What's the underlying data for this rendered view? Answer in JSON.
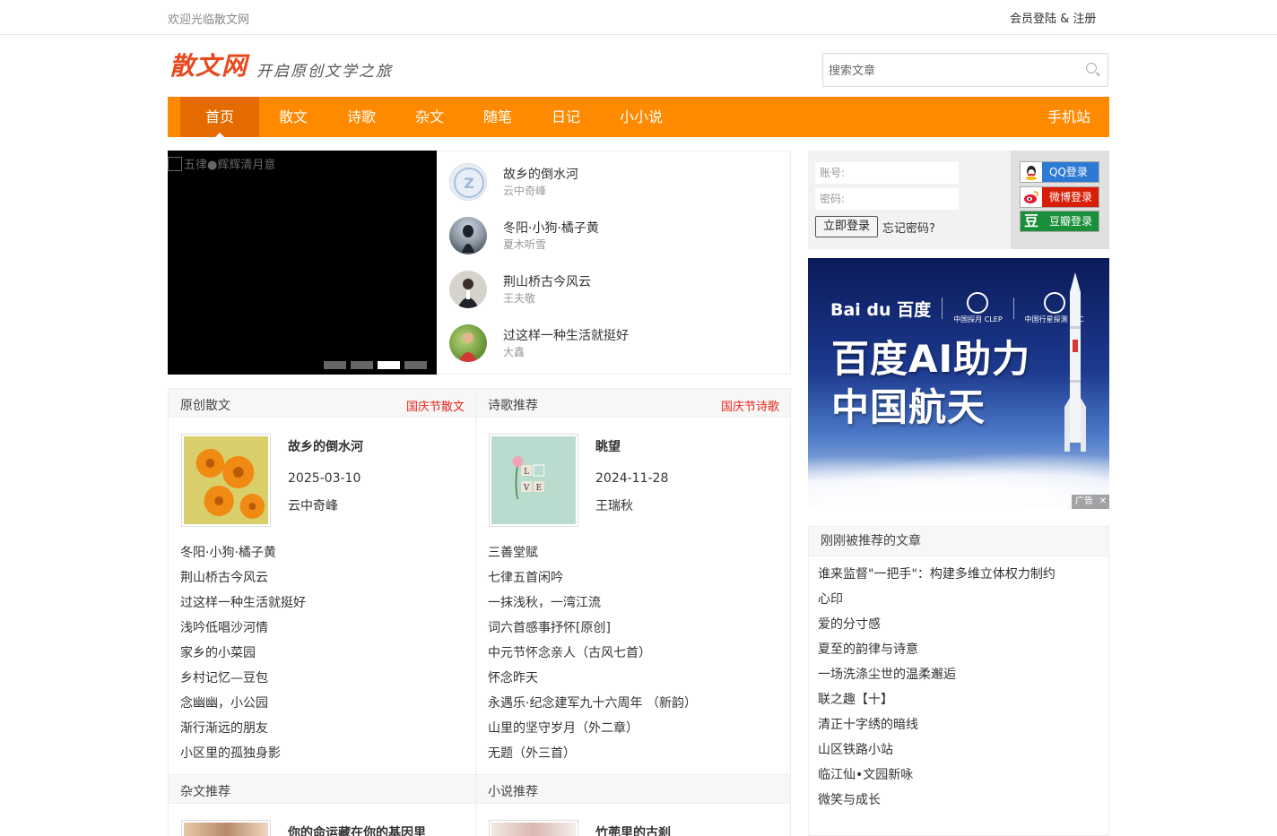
{
  "topbar": {
    "welcome": "欢迎光临散文网",
    "login": "会员登陆 & 注册"
  },
  "header": {
    "logo": "散文网",
    "slogan": "开启原创文学之旅"
  },
  "search": {
    "placeholder": "搜索文章"
  },
  "nav": {
    "items": [
      "首页",
      "散文",
      "诗歌",
      "杂文",
      "随笔",
      "日记",
      "小小说"
    ],
    "mobile": "手机站"
  },
  "slider": {
    "image_alt": "五律●辉辉清月意",
    "slide_count": 4,
    "active_slide": 3
  },
  "featured": [
    {
      "title": "故乡的倒水河",
      "author": "云中奇峰"
    },
    {
      "title": "冬阳·小狗·橘子黄",
      "author": "夏木听雪"
    },
    {
      "title": "荆山桥古今风云",
      "author": "王夫敬"
    },
    {
      "title": "过这样一种生活就挺好",
      "author": "大鑫"
    }
  ],
  "login": {
    "account_placeholder": "账号:",
    "password_placeholder": "密码:",
    "submit": "立即登录",
    "forgot": "忘记密码?",
    "qq": "QQ登录",
    "weibo": "微博登录",
    "douban": "豆瓣登录",
    "douban_logo": "豆"
  },
  "ad": {
    "baidu": "Bai du 百度",
    "org1": "中国探月 CLEP",
    "org2": "中国行星探测 PEC",
    "line1": "百度AI助力",
    "line2": "中国航天",
    "tag": "广告",
    "close": "✕"
  },
  "prose": {
    "title": "原创散文",
    "more": "国庆节散文",
    "post": {
      "title": "故乡的倒水河",
      "date": "2025-03-10",
      "author": "云中奇峰"
    },
    "list": [
      "冬阳·小狗·橘子黄",
      "荆山桥古今风云",
      "过这样一种生活就挺好",
      "浅吟低唱沙河情",
      "家乡的小菜园",
      "乡村记忆—豆包",
      "念幽幽，小公园",
      "渐行渐远的朋友",
      "小区里的孤独身影"
    ]
  },
  "poetry": {
    "title": "诗歌推荐",
    "more": "国庆节诗歌",
    "post": {
      "title": "眺望",
      "date": "2024-11-28",
      "author": "王瑞秋"
    },
    "list": [
      "三善堂赋",
      "七律五首闲吟",
      "一抹浅秋，一湾江流",
      "词六首感事抒怀[原创]",
      "中元节怀念亲人（古风七首）",
      "怀念昨天",
      "永遇乐·纪念建军九十六周年 （新韵）",
      "山里的坚守岁月（外二章）",
      "无题（外三首）"
    ]
  },
  "essay": {
    "title": "杂文推荐",
    "post_title": "你的命运藏在你的基因里"
  },
  "novel": {
    "title": "小说推荐",
    "post_title": "竹蔸里的古刹"
  },
  "recent": {
    "title": "刚刚被推荐的文章",
    "list": [
      "谁来监督\"一把手\"：构建多维立体权力制约",
      "心印",
      "爱的分寸感",
      "夏至的韵律与诗意",
      "一场洗涤尘世的温柔邂逅",
      "联之趣【十】",
      "清正十字绣的暗线",
      "山区铁路小站",
      "临江仙•文园新咏",
      "微笑与成长"
    ]
  }
}
